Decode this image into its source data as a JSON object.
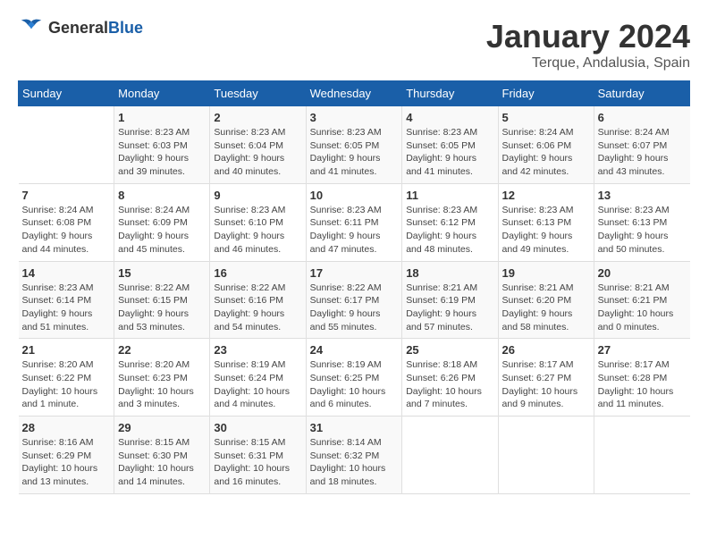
{
  "logo": {
    "general": "General",
    "blue": "Blue"
  },
  "header": {
    "title": "January 2024",
    "location": "Terque, Andalusia, Spain"
  },
  "days_of_week": [
    "Sunday",
    "Monday",
    "Tuesday",
    "Wednesday",
    "Thursday",
    "Friday",
    "Saturday"
  ],
  "weeks": [
    [
      {
        "day": "",
        "info": ""
      },
      {
        "day": "1",
        "info": "Sunrise: 8:23 AM\nSunset: 6:03 PM\nDaylight: 9 hours\nand 39 minutes."
      },
      {
        "day": "2",
        "info": "Sunrise: 8:23 AM\nSunset: 6:04 PM\nDaylight: 9 hours\nand 40 minutes."
      },
      {
        "day": "3",
        "info": "Sunrise: 8:23 AM\nSunset: 6:05 PM\nDaylight: 9 hours\nand 41 minutes."
      },
      {
        "day": "4",
        "info": "Sunrise: 8:23 AM\nSunset: 6:05 PM\nDaylight: 9 hours\nand 41 minutes."
      },
      {
        "day": "5",
        "info": "Sunrise: 8:24 AM\nSunset: 6:06 PM\nDaylight: 9 hours\nand 42 minutes."
      },
      {
        "day": "6",
        "info": "Sunrise: 8:24 AM\nSunset: 6:07 PM\nDaylight: 9 hours\nand 43 minutes."
      }
    ],
    [
      {
        "day": "7",
        "info": "Sunrise: 8:24 AM\nSunset: 6:08 PM\nDaylight: 9 hours\nand 44 minutes."
      },
      {
        "day": "8",
        "info": "Sunrise: 8:24 AM\nSunset: 6:09 PM\nDaylight: 9 hours\nand 45 minutes."
      },
      {
        "day": "9",
        "info": "Sunrise: 8:23 AM\nSunset: 6:10 PM\nDaylight: 9 hours\nand 46 minutes."
      },
      {
        "day": "10",
        "info": "Sunrise: 8:23 AM\nSunset: 6:11 PM\nDaylight: 9 hours\nand 47 minutes."
      },
      {
        "day": "11",
        "info": "Sunrise: 8:23 AM\nSunset: 6:12 PM\nDaylight: 9 hours\nand 48 minutes."
      },
      {
        "day": "12",
        "info": "Sunrise: 8:23 AM\nSunset: 6:13 PM\nDaylight: 9 hours\nand 49 minutes."
      },
      {
        "day": "13",
        "info": "Sunrise: 8:23 AM\nSunset: 6:13 PM\nDaylight: 9 hours\nand 50 minutes."
      }
    ],
    [
      {
        "day": "14",
        "info": "Sunrise: 8:23 AM\nSunset: 6:14 PM\nDaylight: 9 hours\nand 51 minutes."
      },
      {
        "day": "15",
        "info": "Sunrise: 8:22 AM\nSunset: 6:15 PM\nDaylight: 9 hours\nand 53 minutes."
      },
      {
        "day": "16",
        "info": "Sunrise: 8:22 AM\nSunset: 6:16 PM\nDaylight: 9 hours\nand 54 minutes."
      },
      {
        "day": "17",
        "info": "Sunrise: 8:22 AM\nSunset: 6:17 PM\nDaylight: 9 hours\nand 55 minutes."
      },
      {
        "day": "18",
        "info": "Sunrise: 8:21 AM\nSunset: 6:19 PM\nDaylight: 9 hours\nand 57 minutes."
      },
      {
        "day": "19",
        "info": "Sunrise: 8:21 AM\nSunset: 6:20 PM\nDaylight: 9 hours\nand 58 minutes."
      },
      {
        "day": "20",
        "info": "Sunrise: 8:21 AM\nSunset: 6:21 PM\nDaylight: 10 hours\nand 0 minutes."
      }
    ],
    [
      {
        "day": "21",
        "info": "Sunrise: 8:20 AM\nSunset: 6:22 PM\nDaylight: 10 hours\nand 1 minute."
      },
      {
        "day": "22",
        "info": "Sunrise: 8:20 AM\nSunset: 6:23 PM\nDaylight: 10 hours\nand 3 minutes."
      },
      {
        "day": "23",
        "info": "Sunrise: 8:19 AM\nSunset: 6:24 PM\nDaylight: 10 hours\nand 4 minutes."
      },
      {
        "day": "24",
        "info": "Sunrise: 8:19 AM\nSunset: 6:25 PM\nDaylight: 10 hours\nand 6 minutes."
      },
      {
        "day": "25",
        "info": "Sunrise: 8:18 AM\nSunset: 6:26 PM\nDaylight: 10 hours\nand 7 minutes."
      },
      {
        "day": "26",
        "info": "Sunrise: 8:17 AM\nSunset: 6:27 PM\nDaylight: 10 hours\nand 9 minutes."
      },
      {
        "day": "27",
        "info": "Sunrise: 8:17 AM\nSunset: 6:28 PM\nDaylight: 10 hours\nand 11 minutes."
      }
    ],
    [
      {
        "day": "28",
        "info": "Sunrise: 8:16 AM\nSunset: 6:29 PM\nDaylight: 10 hours\nand 13 minutes."
      },
      {
        "day": "29",
        "info": "Sunrise: 8:15 AM\nSunset: 6:30 PM\nDaylight: 10 hours\nand 14 minutes."
      },
      {
        "day": "30",
        "info": "Sunrise: 8:15 AM\nSunset: 6:31 PM\nDaylight: 10 hours\nand 16 minutes."
      },
      {
        "day": "31",
        "info": "Sunrise: 8:14 AM\nSunset: 6:32 PM\nDaylight: 10 hours\nand 18 minutes."
      },
      {
        "day": "",
        "info": ""
      },
      {
        "day": "",
        "info": ""
      },
      {
        "day": "",
        "info": ""
      }
    ]
  ]
}
